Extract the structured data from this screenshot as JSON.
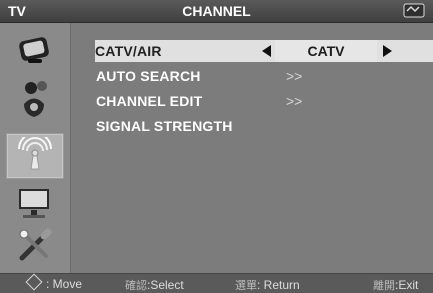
{
  "header": {
    "left_label": "TV",
    "title": "CHANNEL"
  },
  "sidebar": {
    "items": [
      {
        "icon": "picture-icon"
      },
      {
        "icon": "sound-icon"
      },
      {
        "icon": "channel-icon",
        "selected": true
      },
      {
        "icon": "display-icon"
      },
      {
        "icon": "setup-icon"
      }
    ]
  },
  "menu": {
    "rows": [
      {
        "label": "CATV/AIR",
        "value": "CATV"
      },
      {
        "label": "AUTO SEARCH",
        "value": ">>"
      },
      {
        "label": "CHANNEL EDIT",
        "value": ">>"
      },
      {
        "label": "SIGNAL STRENGTH",
        "value": ""
      }
    ]
  },
  "footer": {
    "move": ": Move",
    "select_prefix": "確認",
    "select": ":Select",
    "return_prefix": "選單",
    "return": ": Return",
    "exit_prefix": "離開",
    "exit": ":Exit"
  },
  "colors": {
    "titlebar": "#4a4a4a",
    "background": "#7c7c7c",
    "highlight": "#e0e0e0"
  }
}
